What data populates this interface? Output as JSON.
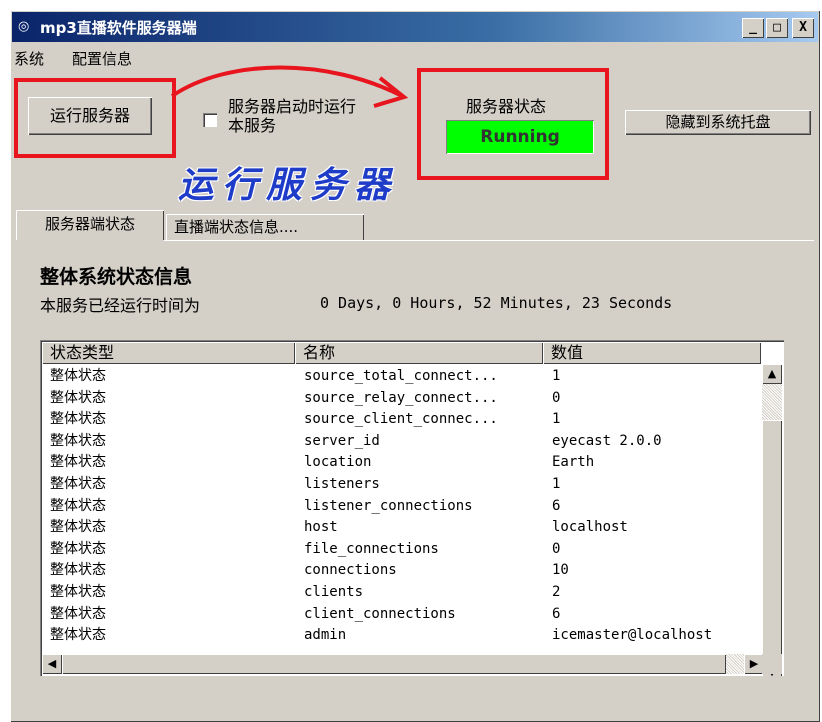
{
  "window": {
    "title": "mp3直播软件服务器端",
    "icon": "app-icon"
  },
  "titlebar_buttons": {
    "minimize": "_",
    "maximize": "□",
    "close": "X"
  },
  "menu": [
    "系统",
    "配置信息"
  ],
  "controls": {
    "run_button": "运行服务器",
    "autostart_label_line1": "服务器启动时运行",
    "autostart_label_line2": "本服务",
    "autostart_checked": false,
    "status_title": "服务器状态",
    "status_value": "Running",
    "hide_button": "隐藏到系统托盘",
    "annotation": "运行服务器"
  },
  "colors": {
    "status_bg": "#00ff00",
    "annotation_red": "#e8141e",
    "annotation_blue": "#1e3cc8"
  },
  "tabs": [
    "服务器端状态",
    "直播端状态信息...."
  ],
  "overview": {
    "heading": "整体系统状态信息",
    "uptime_label": "本服务已经运行时间为",
    "uptime_value": "0 Days, 0 Hours, 52 Minutes, 23 Seconds"
  },
  "table": {
    "columns": [
      "状态类型",
      "名称",
      "数值"
    ],
    "rows": [
      [
        "整体状态",
        "source_total_connect...",
        "1"
      ],
      [
        "整体状态",
        "source_relay_connect...",
        "0"
      ],
      [
        "整体状态",
        "source_client_connec...",
        "1"
      ],
      [
        "整体状态",
        "server_id",
        "eyecast 2.0.0"
      ],
      [
        "整体状态",
        "location",
        "Earth"
      ],
      [
        "整体状态",
        "listeners",
        "1"
      ],
      [
        "整体状态",
        "listener_connections",
        "6"
      ],
      [
        "整体状态",
        "host",
        "localhost"
      ],
      [
        "整体状态",
        "file_connections",
        "0"
      ],
      [
        "整体状态",
        "connections",
        "10"
      ],
      [
        "整体状态",
        "clients",
        "2"
      ],
      [
        "整体状态",
        "client_connections",
        "6"
      ],
      [
        "整体状态",
        "admin",
        "icemaster@localhost"
      ]
    ]
  }
}
